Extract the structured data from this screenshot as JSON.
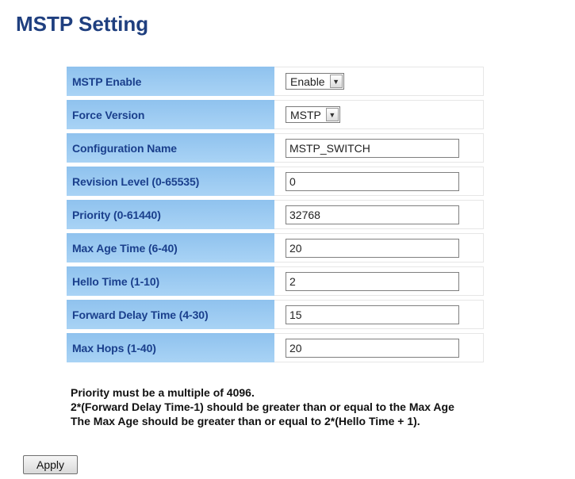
{
  "page": {
    "title": "MSTP Setting"
  },
  "settings": {
    "mstp_enable": {
      "label": "MSTP Enable",
      "value": "Enable"
    },
    "force_version": {
      "label": "Force Version",
      "value": "MSTP"
    },
    "configuration_name": {
      "label": "Configuration Name",
      "value": "MSTP_SWITCH"
    },
    "revision_level": {
      "label": "Revision Level (0-65535)",
      "value": "0"
    },
    "priority": {
      "label": "Priority (0-61440)",
      "value": "32768"
    },
    "max_age_time": {
      "label": "Max Age Time (6-40)",
      "value": "20"
    },
    "hello_time": {
      "label": "Hello Time (1-10)",
      "value": "2"
    },
    "forward_delay_time": {
      "label": "Forward Delay Time (4-30)",
      "value": "15"
    },
    "max_hops": {
      "label": "Max Hops (1-40)",
      "value": "20"
    }
  },
  "notes": [
    "Priority must be a multiple of 4096.",
    "2*(Forward Delay Time-1) should be greater than or equal to the Max Age",
    "The Max Age should be greater than or equal to 2*(Hello Time + 1)."
  ],
  "buttons": {
    "apply": "Apply"
  },
  "icons": {
    "dropdown": "chevron-down-icon"
  },
  "colors": {
    "title": "#1f3f7f",
    "label_bg": "#9ccbf2",
    "label_text": "#1a3f8c"
  }
}
